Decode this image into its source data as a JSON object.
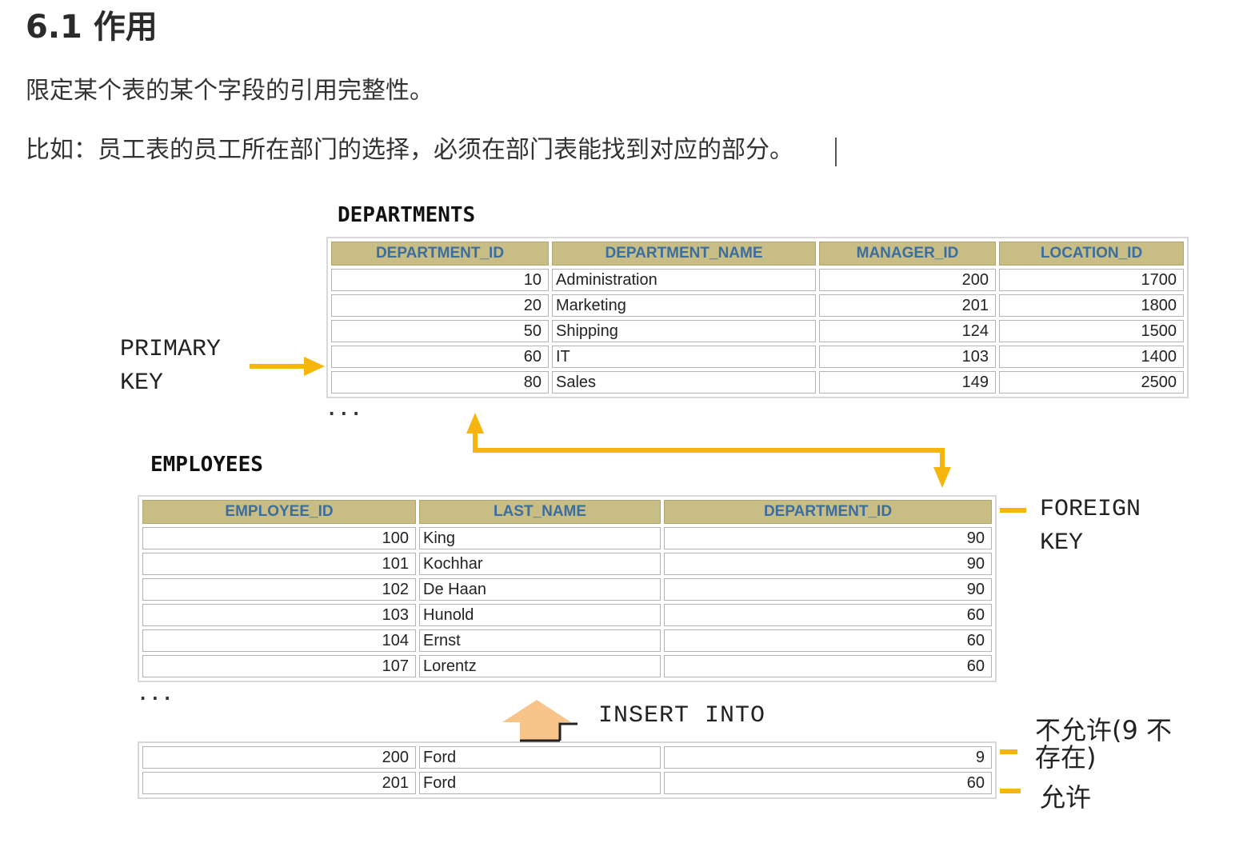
{
  "heading": "6.1 作用",
  "paragraphs": [
    "限定某个表的某个字段的引用完整性。",
    "比如：员工表的员工所在部门的选择，必须在部门表能找到对应的部分。"
  ],
  "departments": {
    "title": "DEPARTMENTS",
    "columns": [
      "DEPARTMENT_ID",
      "DEPARTMENT_NAME",
      "MANAGER_ID",
      "LOCATION_ID"
    ],
    "rows": [
      [
        "10",
        "Administration",
        "200",
        "1700"
      ],
      [
        "20",
        "Marketing",
        "201",
        "1800"
      ],
      [
        "50",
        "Shipping",
        "124",
        "1500"
      ],
      [
        "60",
        "IT",
        "103",
        "1400"
      ],
      [
        "80",
        "Sales",
        "149",
        "2500"
      ]
    ],
    "ellipsis": "..."
  },
  "primary_key_label": "PRIMARY\nKEY",
  "employees": {
    "title": "EMPLOYEES",
    "columns": [
      "EMPLOYEE_ID",
      "LAST_NAME",
      "DEPARTMENT_ID"
    ],
    "rows": [
      [
        "100",
        "King",
        "90"
      ],
      [
        "101",
        "Kochhar",
        "90"
      ],
      [
        "102",
        "De Haan",
        "90"
      ],
      [
        "103",
        "Hunold",
        "60"
      ],
      [
        "104",
        "Ernst",
        "60"
      ],
      [
        "107",
        "Lorentz",
        "60"
      ]
    ],
    "ellipsis": "..."
  },
  "foreign_key_label": "FOREIGN\nKEY",
  "insert_into_label": "INSERT INTO",
  "insert_rows": [
    [
      "200",
      "Ford",
      "9"
    ],
    [
      "201",
      "Ford",
      "60"
    ]
  ],
  "notes": {
    "not_allowed": "不允许(9 不存在)",
    "allowed": "允许"
  },
  "colors": {
    "arrow": "#f5b50c",
    "insert_arrow": "#f7c48a",
    "header_bg": "#c9bd86",
    "header_text": "#3a6e9e"
  }
}
